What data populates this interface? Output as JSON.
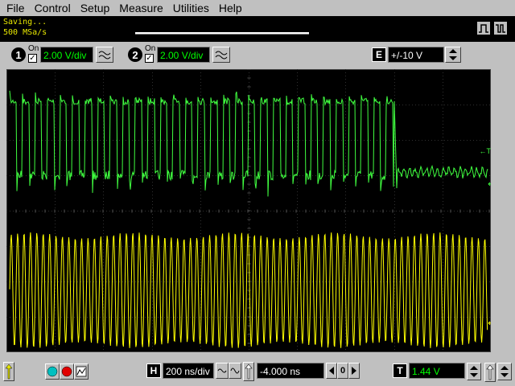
{
  "menu": {
    "items": [
      {
        "label": "File"
      },
      {
        "label": "Control"
      },
      {
        "label": "Setup"
      },
      {
        "label": "Measure"
      },
      {
        "label": "Utilities"
      },
      {
        "label": "Help"
      }
    ]
  },
  "status": {
    "message": "Saving...",
    "sample_rate": "500 MSa/s",
    "progress": 1.0
  },
  "channels": [
    {
      "number": "1",
      "on_label": "On",
      "scale": "2.00 V/div",
      "color": "#00ff00",
      "checked": "✓"
    },
    {
      "number": "2",
      "on_label": "On",
      "scale": "2.00 V/div",
      "color": "#ffff00",
      "checked": "✓"
    }
  ],
  "external": {
    "label": "E",
    "range": "+/-10 V"
  },
  "waveform": {
    "ch1_color": "#40ff40",
    "ch2_color": "#ffff00",
    "trigger_marker": "←T"
  },
  "horizontal": {
    "label": "H",
    "scale": "200 ns/div",
    "position": "-4.000 ns",
    "reference": "0"
  },
  "trigger": {
    "label": "T",
    "level": "1.44 V"
  },
  "icons": {
    "run": "run-icon",
    "stop": "stop-icon",
    "single": "single-icon"
  }
}
